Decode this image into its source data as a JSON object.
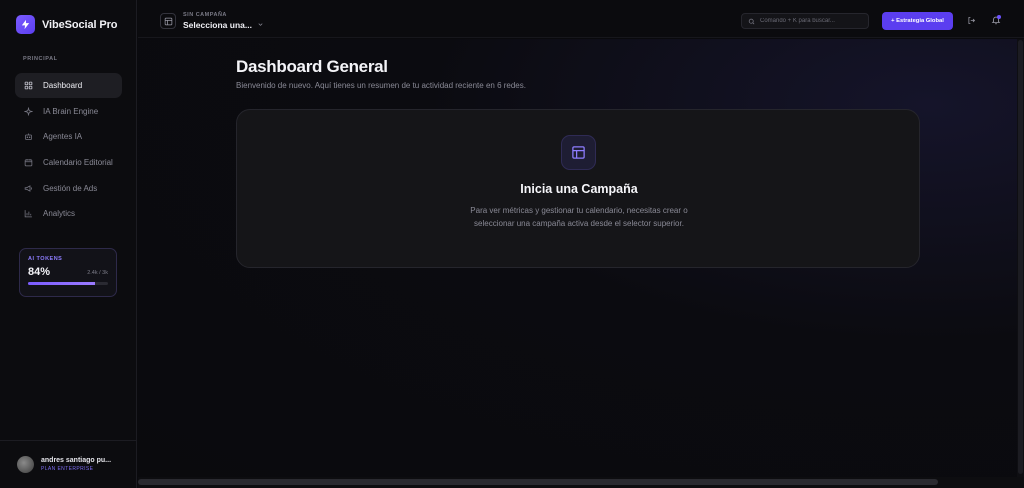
{
  "brand": {
    "name": "VibeSocial Pro",
    "icon": "lightning-icon"
  },
  "sidebar": {
    "section_label": "PRINCIPAL",
    "items": [
      {
        "label": "Dashboard",
        "icon": "grid-icon",
        "active": true
      },
      {
        "label": "IA Brain Engine",
        "icon": "sparkle-icon",
        "active": false
      },
      {
        "label": "Agentes IA",
        "icon": "bot-icon",
        "active": false
      },
      {
        "label": "Calendario Editorial",
        "icon": "calendar-icon",
        "active": false
      },
      {
        "label": "Gestión de Ads",
        "icon": "megaphone-icon",
        "active": false
      },
      {
        "label": "Analytics",
        "icon": "bar-chart-icon",
        "active": false
      }
    ],
    "tokens": {
      "title": "AI TOKENS",
      "percent": "84%",
      "count": "2.4k / 3k",
      "progress": 0.84
    },
    "user": {
      "name": "andres santiago pu...",
      "plan": "PLAN ENTERPRISE"
    }
  },
  "topbar": {
    "campaign_label": "SIN CAMPAÑA",
    "campaign_select": "Selecciona una...",
    "search_placeholder": "Comando + K para buscar...",
    "primary_button": "+ Estrategia Global"
  },
  "main": {
    "title": "Dashboard General",
    "subtitle": "Bienvenido de nuevo. Aquí tienes un resumen de tu actividad reciente en 6 redes.",
    "card": {
      "title": "Inicia una Campaña",
      "text": "Para ver métricas y gestionar tu calendario, necesitas crear o seleccionar una campaña activa desde el selector superior."
    }
  },
  "colors": {
    "accent": "#5b3ef0",
    "background": "#0a0a0d",
    "card": "#151518"
  }
}
